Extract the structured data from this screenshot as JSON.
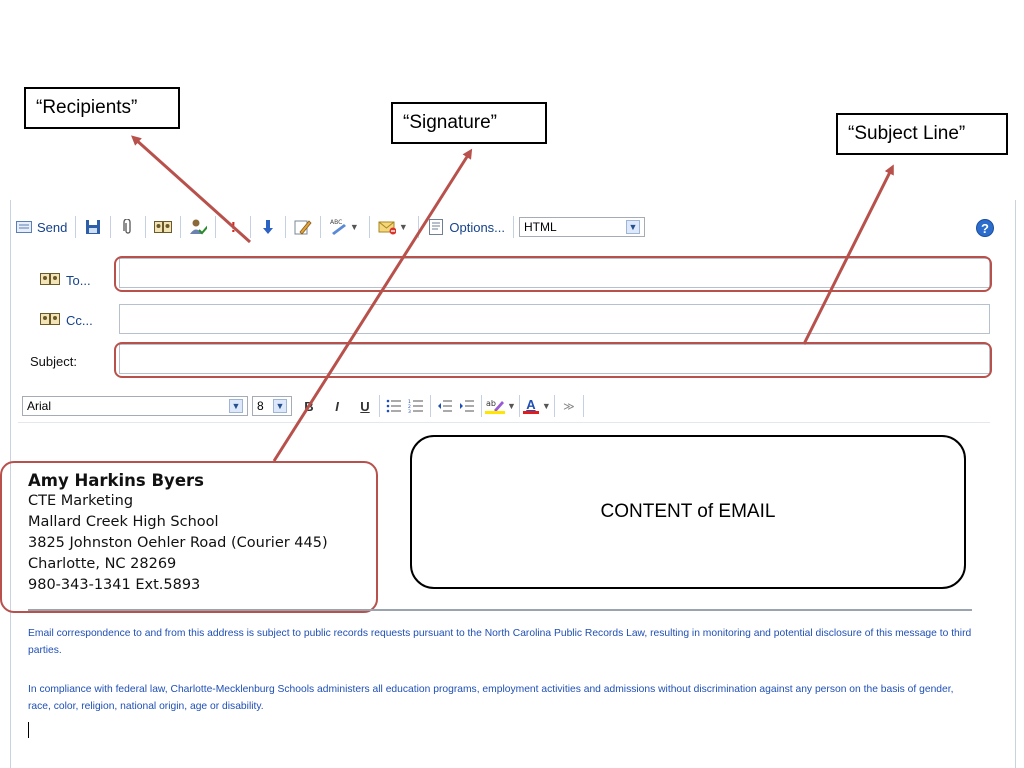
{
  "callouts": {
    "recipients": "“Recipients”",
    "signature": "“Signature”",
    "subject_line": "“Subject Line”"
  },
  "toolbar": {
    "send_label": "Send",
    "options_label": "Options...",
    "format_value": "HTML"
  },
  "fields": {
    "to_label": "To...",
    "cc_label": "Cc...",
    "subject_label": "Subject:",
    "to_value": "",
    "cc_value": "",
    "subject_value": ""
  },
  "format_bar": {
    "font_value": "Arial",
    "size_value": "8",
    "bold_label": "B",
    "italic_label": "I",
    "underline_label": "U",
    "font_color_label": "A"
  },
  "signature": {
    "name": "Amy Harkins Byers",
    "line1": "CTE Marketing",
    "line2": "Mallard Creek High School",
    "line3": "3825 Johnston Oehler Road (Courier 445)",
    "line4": "Charlotte, NC 28269",
    "line5": "980-343-1341 Ext.5893"
  },
  "content_label": "CONTENT of EMAIL",
  "disclaimer": {
    "para1": "Email correspondence to and from this address is subject to public records requests pursuant to the North Carolina Public Records Law, resulting in monitoring and potential disclosure of this message to third parties.",
    "para2": "In compliance with federal law, Charlotte-Mecklenburg Schools administers all education programs, employment activities and admissions without discrimination against any person on the basis of gender, race, color, religion, national origin, age or disability."
  },
  "colors": {
    "arrow": "#b8514b",
    "link_blue": "#1f4fb5"
  }
}
